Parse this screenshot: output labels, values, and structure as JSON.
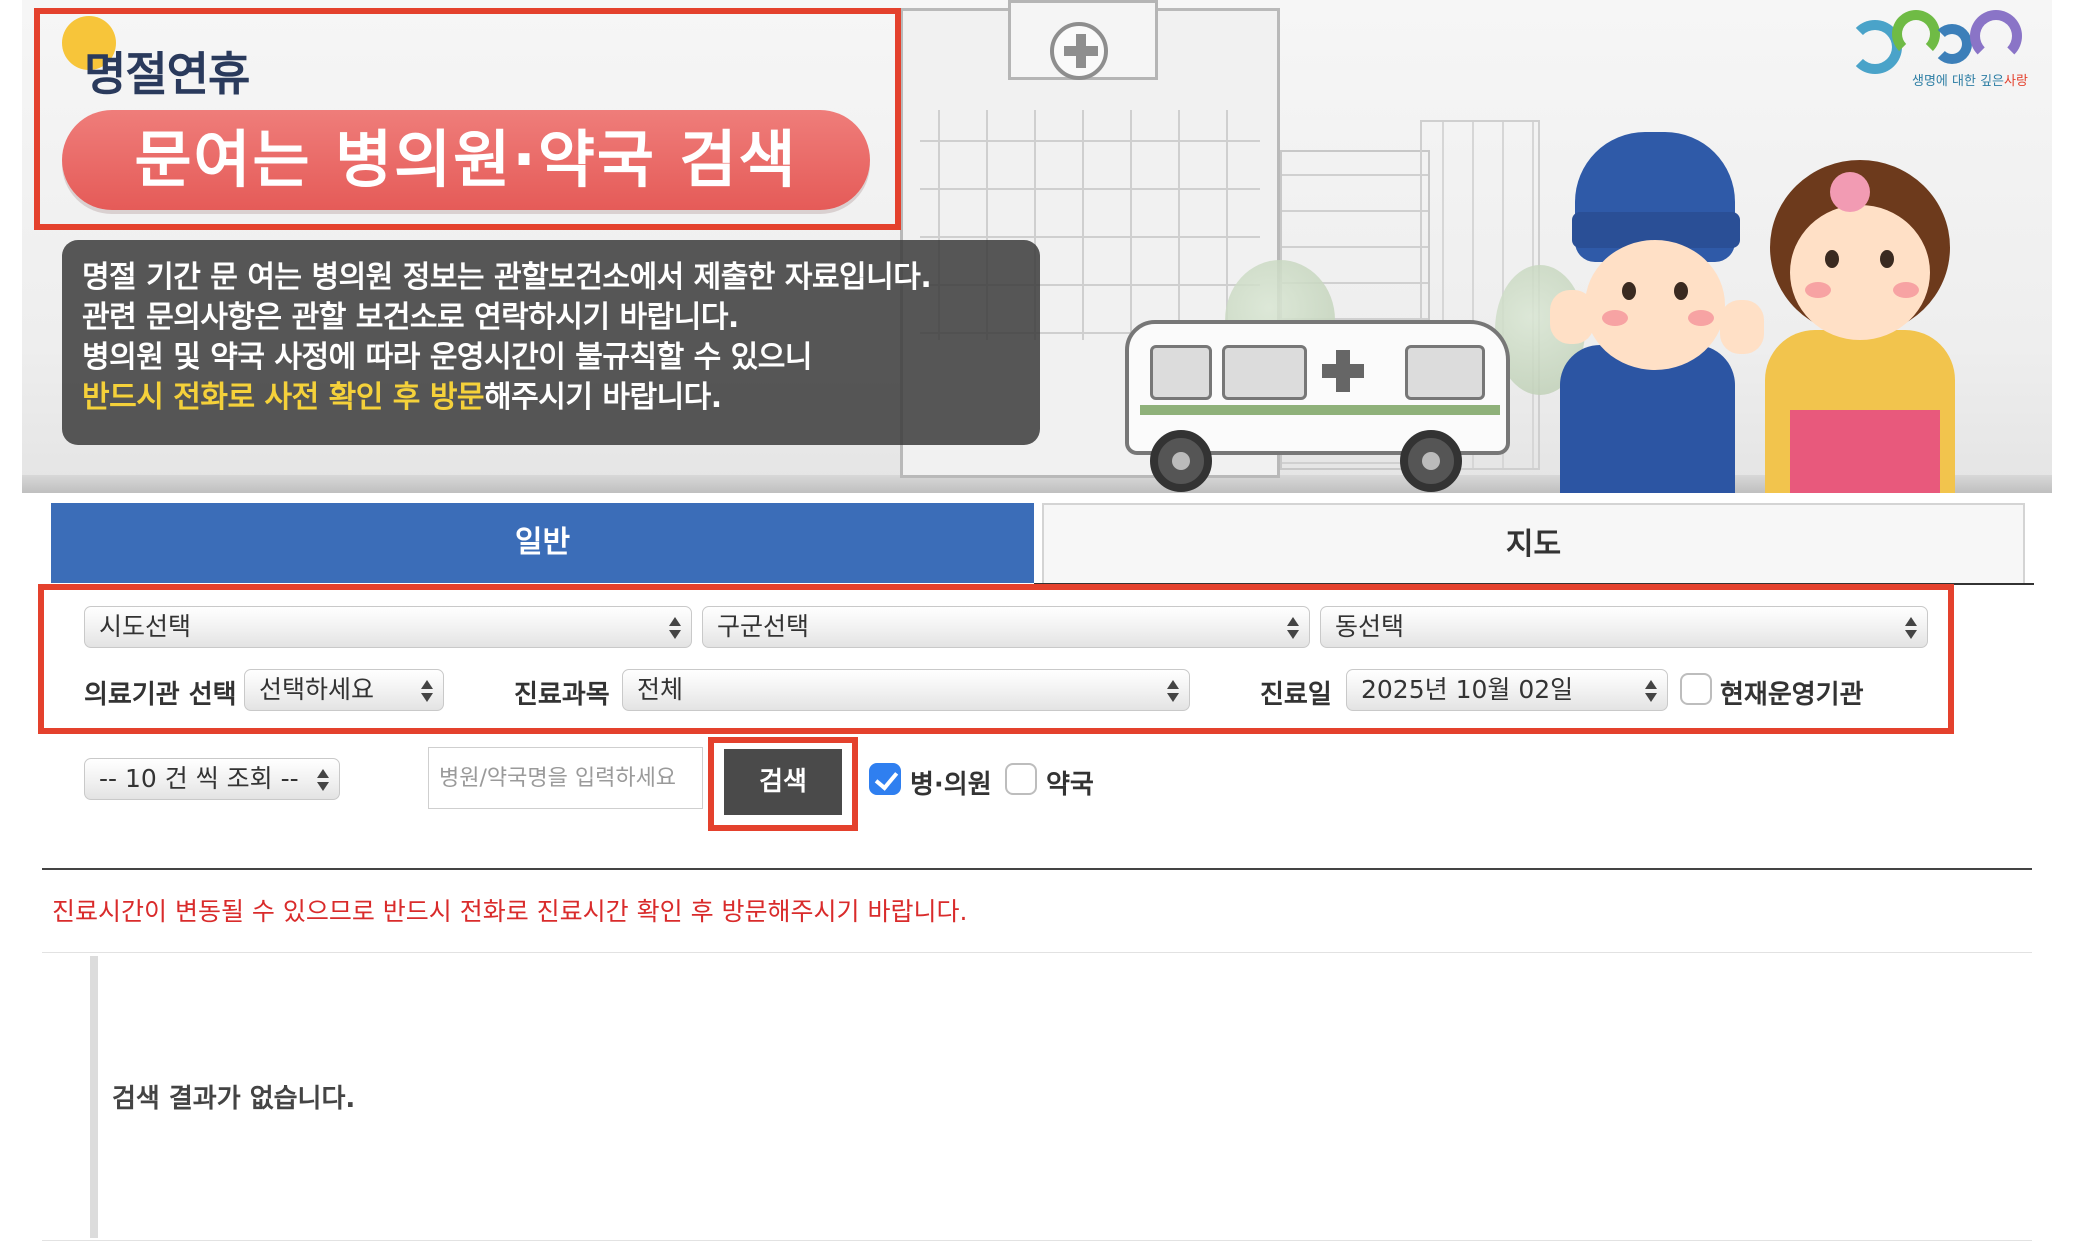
{
  "banner": {
    "title_small": "명절연휴",
    "title_main": "문여는 병의원·약국 검색",
    "notice_lines": [
      "명절 기간 문 여는 병의원 정보는 관할보건소에서 제출한 자료입니다.",
      "관련 문의사항은 관할 보건소로 연락하시기 바랍니다.",
      "병의원 및 약국 사정에 따라 운영시간이 불규칙할 수 있으니"
    ],
    "notice_highlight": "반드시 전화로 사전 확인 후 방문",
    "notice_tail": "해주시기 바랍니다.",
    "logo_slogan_a": "생명에 대한 깊은",
    "logo_slogan_b": "사랑",
    "colors": {
      "title_pill": "#e55b58",
      "notice_bg": "#3c3c3c",
      "highlight": "#f5d13a",
      "outline": "#e4412d"
    }
  },
  "tabs": [
    {
      "label": "일반",
      "active": true
    },
    {
      "label": "지도",
      "active": false
    }
  ],
  "filters": {
    "sido": "시도선택",
    "gugun": "구군선택",
    "dong": "동선택",
    "institution_label": "의료기관 선택",
    "institution_value": "선택하세요",
    "department_label": "진료과목",
    "department_value": "전체",
    "date_label": "진료일",
    "date_value": "2025년 10월 02일",
    "operating_label": "현재운영기관",
    "operating_checked": false
  },
  "search": {
    "page_size": "-- 10 건 씩 조회 --",
    "placeholder": "병원/약국명을 입력하세요",
    "button": "검색",
    "hospital_label": "병·의원",
    "hospital_checked": true,
    "pharmacy_label": "약국",
    "pharmacy_checked": false
  },
  "warning": "진료시간이 변동될 수 있으므로 반드시 전화로 진료시간 확인 후 방문해주시기 바랍니다.",
  "result": {
    "empty_message": "검색 결과가 없습니다."
  },
  "accent_color": "#3b6db8"
}
